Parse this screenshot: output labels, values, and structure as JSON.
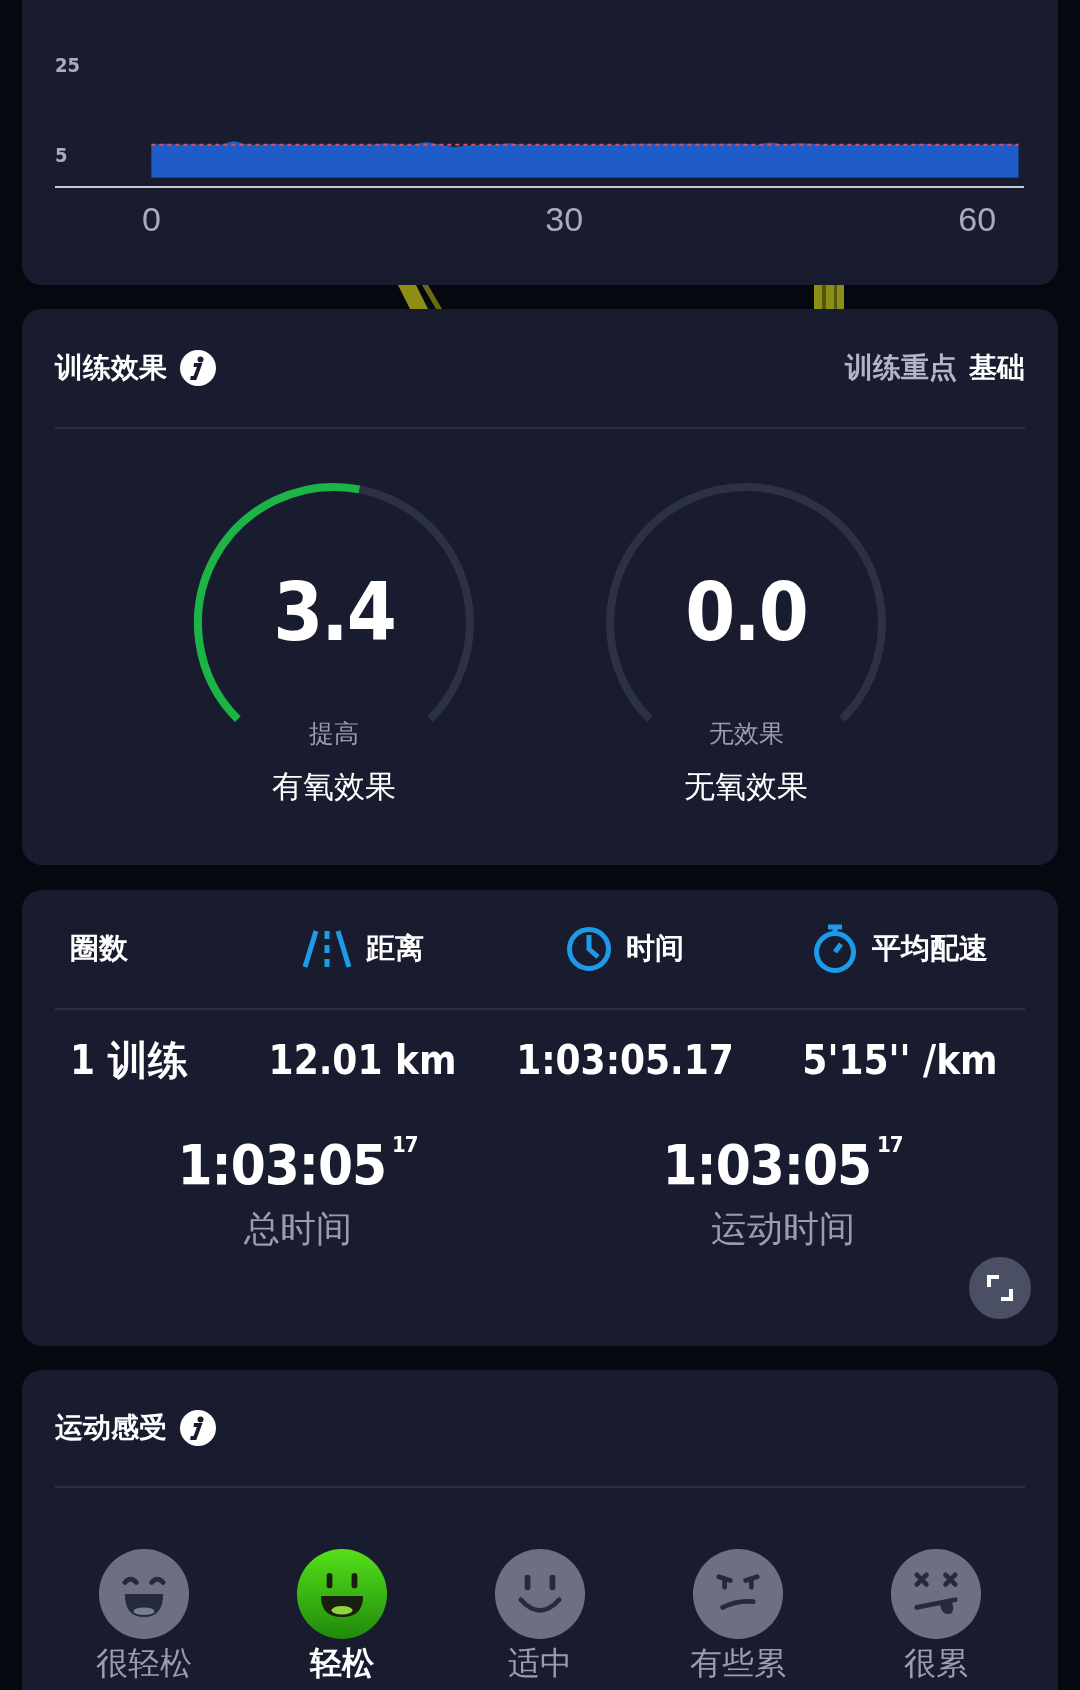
{
  "speed_chart": {
    "chart_data": {
      "type": "area",
      "x": [
        0,
        1,
        2,
        3,
        4,
        5,
        6,
        7,
        8,
        9,
        10,
        11,
        12,
        13,
        14,
        15,
        16,
        17,
        18,
        19,
        20,
        21,
        22,
        23,
        24,
        25,
        26,
        27,
        28,
        29,
        30,
        31,
        32,
        33,
        34,
        35,
        36,
        37,
        38,
        39,
        40,
        41,
        42,
        43,
        44,
        45,
        46,
        47,
        48,
        49,
        50,
        51,
        52,
        53,
        54,
        55,
        56,
        57,
        58,
        59,
        60,
        61,
        62,
        63
      ],
      "series": [
        {
          "color": "#1f5cc8",
          "values": [
            7.3,
            7.5,
            7.3,
            7.4,
            7.3,
            7.3,
            8.1,
            7.3,
            7.3,
            7.5,
            7.3,
            7.3,
            7.3,
            7.3,
            7.3,
            7.3,
            7.3,
            7.6,
            7.3,
            7.3,
            7.9,
            7.3,
            6.8,
            7.1,
            7.3,
            7.3,
            7.6,
            7.3,
            7.3,
            7.3,
            7.3,
            7.3,
            7.3,
            7.3,
            7.3,
            7.5,
            7.5,
            7.5,
            7.5,
            7.5,
            7.5,
            7.5,
            7.5,
            7.5,
            7.3,
            7.8,
            7.3,
            7.6,
            7.5,
            7.3,
            7.3,
            7.3,
            7.3,
            7.3,
            7.3,
            7.3,
            7.5,
            7.3,
            7.3,
            7.3,
            7.3,
            7.3,
            7.5,
            7.3
          ]
        }
      ],
      "xlim": [
        -7,
        63.4
      ],
      "ylim": [
        -2.33,
        37.67
      ],
      "xticks": [
        0,
        30,
        60
      ],
      "yticks": [
        5,
        25
      ],
      "ref_lines": [
        {
          "axis": "y",
          "value": 7.3,
          "color": "#e0505a"
        }
      ]
    }
  },
  "training_effect": {
    "title": "训练效果",
    "focus_label": "训练重点",
    "focus_value": "基础",
    "gauges": [
      {
        "value": "3.4",
        "rating": "提高",
        "name": "有氧效果"
      },
      {
        "value": "0.0",
        "rating": "无效果",
        "name": "无氧效果"
      }
    ]
  },
  "laps": {
    "columns": [
      {
        "label": "圈数",
        "kind": "plain"
      },
      {
        "label": "距离",
        "kind": "road"
      },
      {
        "label": "时间",
        "kind": "clock"
      },
      {
        "label": "平均配速",
        "kind": "stopwatch"
      }
    ],
    "rows": [
      [
        "1 训练",
        "12.01 km",
        "1:03:05.17",
        "5'15'' /km"
      ]
    ],
    "totals": [
      {
        "time": "1:03:05",
        "fraction": "17",
        "label": "总时间"
      },
      {
        "time": "1:03:05",
        "fraction": "17",
        "label": "运动时间"
      }
    ]
  },
  "feeling": {
    "title": "运动感受",
    "options": [
      {
        "label": "很轻松",
        "kind": "laugh",
        "selected": false
      },
      {
        "label": "轻松",
        "kind": "grin",
        "selected": true
      },
      {
        "label": "适中",
        "kind": "smile",
        "selected": false
      },
      {
        "label": "有些累",
        "kind": "uneasy",
        "selected": false
      },
      {
        "label": "很累",
        "kind": "dizzy",
        "selected": false
      }
    ]
  }
}
